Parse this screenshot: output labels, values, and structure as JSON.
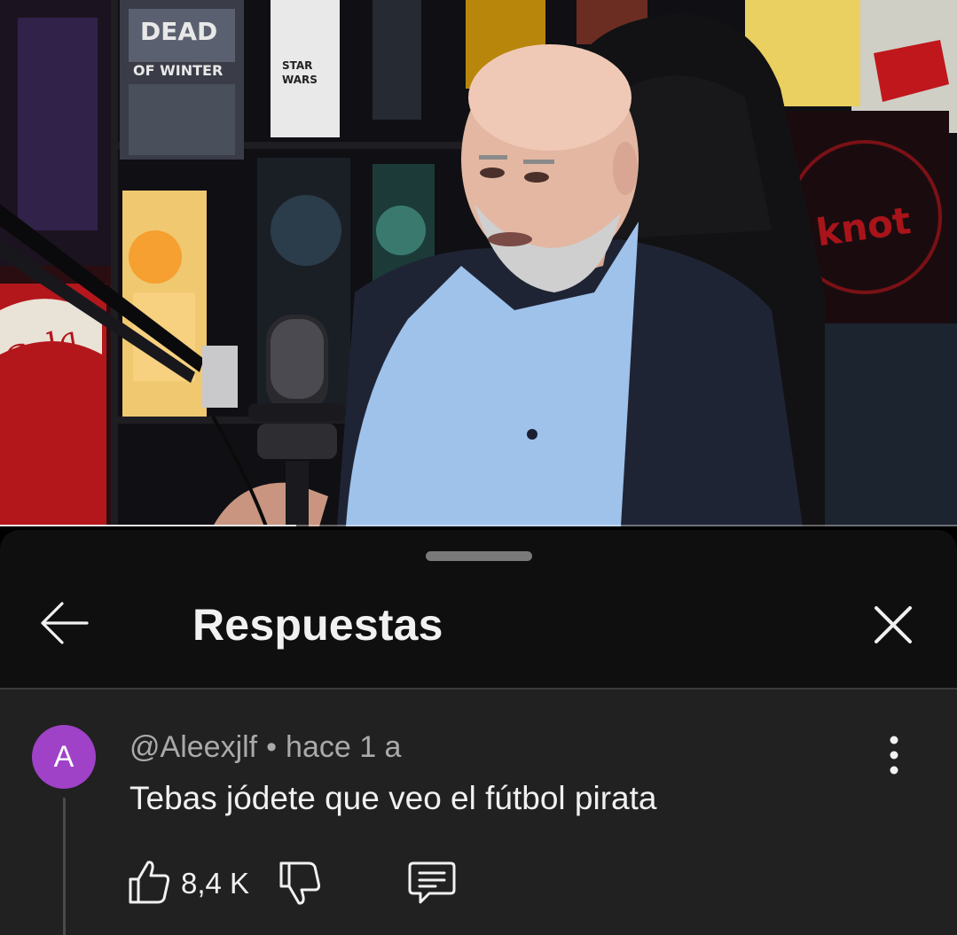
{
  "video": {
    "progress_fraction": 0.31,
    "scene": "podcast-studio-man-with-microphone"
  },
  "sheet": {
    "title": "Respuestas",
    "back_icon": "arrow-left-icon",
    "close_icon": "close-icon"
  },
  "comment": {
    "avatar_letter": "A",
    "avatar_color": "#a042c8",
    "author": "@Aleexjlf",
    "separator": "•",
    "time": "hace 1 a",
    "text": "Tebas jódete que veo el fútbol pirata",
    "likes": "8,4 K",
    "more_icon": "more-vertical-icon",
    "like_icon": "thumbs-up-icon",
    "dislike_icon": "thumbs-down-icon",
    "reply_icon": "comment-icon"
  },
  "colors": {
    "sheet_bg": "#0f0f0f",
    "comment_bg": "#212121",
    "text_primary": "#f1f1f1",
    "text_secondary": "#aaaaaa"
  }
}
